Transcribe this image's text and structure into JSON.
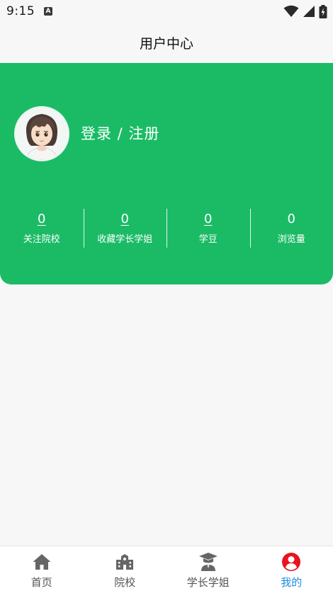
{
  "status_bar": {
    "time": "9:15",
    "notification_icon": "a-badge-icon",
    "icons": [
      "wifi-icon",
      "signal-icon",
      "battery-icon"
    ]
  },
  "header": {
    "title": "用户中心"
  },
  "profile": {
    "avatar_icon": "user-avatar",
    "login_label": "登录 / 注册",
    "card_color": "#1bbb66"
  },
  "stats": [
    {
      "value": "0",
      "label": "关注院校"
    },
    {
      "value": "0",
      "label": "收藏学长学姐"
    },
    {
      "value": "0",
      "label": "学豆"
    },
    {
      "value": "0",
      "label": "浏览量"
    }
  ],
  "tab_bar": {
    "active_color": "#1a8fe0",
    "items": [
      {
        "label": "首页",
        "icon": "home-icon"
      },
      {
        "label": "院校",
        "icon": "school-icon"
      },
      {
        "label": "学长学姐",
        "icon": "graduate-icon"
      },
      {
        "label": "我的",
        "icon": "profile-icon",
        "active": true
      }
    ]
  }
}
